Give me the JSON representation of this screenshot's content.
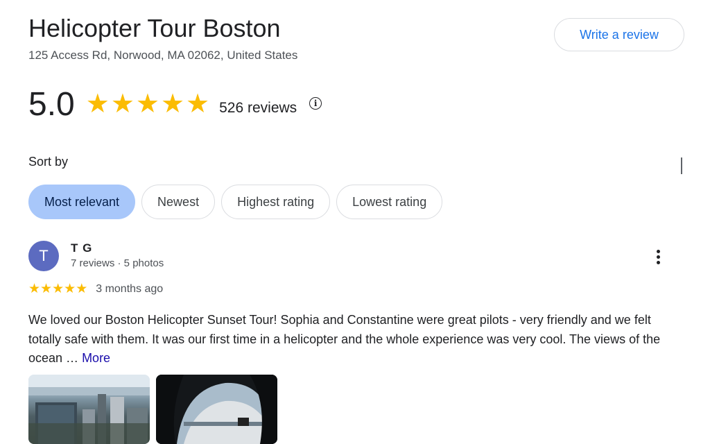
{
  "place": {
    "title": "Helicopter Tour Boston",
    "address": "125 Access Rd, Norwood, MA 02062, United States",
    "write_review_label": "Write a review"
  },
  "rating": {
    "value": "5.0",
    "stars": 5,
    "reviews_count": "526 reviews",
    "info_icon": "info-circle-icon"
  },
  "sort": {
    "label": "Sort by",
    "options": [
      "Most relevant",
      "Newest",
      "Highest rating",
      "Lowest rating"
    ],
    "selected": "Most relevant"
  },
  "review": {
    "avatar_letter": "T",
    "avatar_color": "#5c6bc0",
    "author": "T G",
    "author_meta": "7 reviews · 5 photos",
    "stars": 5,
    "date": "3 months ago",
    "text": "We loved our Boston Helicopter Sunset Tour! Sophia and Constantine were great pilots - very friendly and we felt totally safe with them. It was our first time in a helicopter and the whole experience was very cool. The views of the ocean …",
    "more_label": "More"
  },
  "colors": {
    "star": "#fbbc04",
    "link_blue": "#1a73e8",
    "chip_active": "#a8c7fa",
    "more_link": "#1a0dab"
  }
}
